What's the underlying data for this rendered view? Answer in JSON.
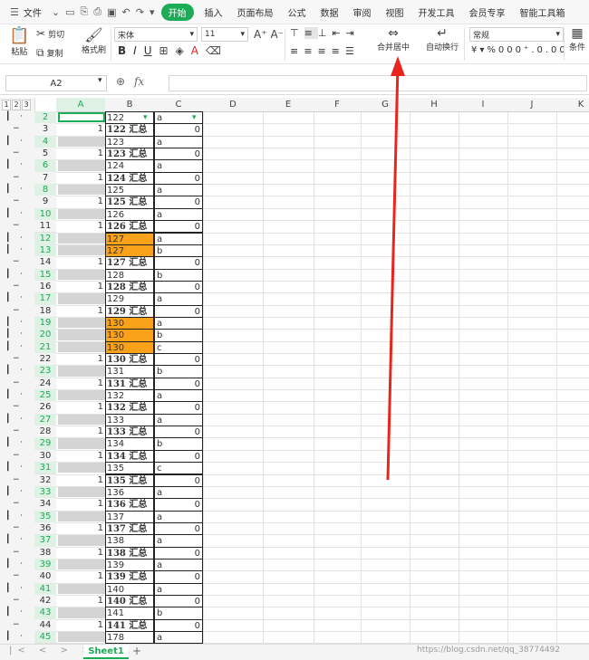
{
  "menubar": {
    "file": "文件",
    "tabs": [
      "开始",
      "插入",
      "页面布局",
      "公式",
      "数据",
      "审阅",
      "视图",
      "开发工具",
      "会员专享",
      "智能工具箱"
    ]
  },
  "ribbon": {
    "cut": "剪切",
    "paste": "粘贴",
    "copy": "复制",
    "format_painter": "格式刷",
    "font_name": "宋体",
    "font_size": "11",
    "bold": "B",
    "italic": "I",
    "underline": "U",
    "merge_center": "合并居中",
    "wrap_text": "自动换行",
    "number_format": "常规",
    "conditional": "条件"
  },
  "formula_bar": {
    "name_box": "A2",
    "fx": "fx",
    "formula": ""
  },
  "columns": [
    "A",
    "B",
    "C",
    "D",
    "E",
    "F",
    "G",
    "H",
    "I",
    "J",
    "K"
  ],
  "outline_levels": [
    "1",
    "2",
    "3"
  ],
  "rows": [
    {
      "n": "2",
      "type": "detail",
      "a": "",
      "b": "122",
      "c": "a",
      "hilite": false
    },
    {
      "n": "3",
      "type": "summary",
      "a": "1",
      "b": "122 汇总",
      "c": "0"
    },
    {
      "n": "4",
      "type": "detail",
      "a": "",
      "b": "123",
      "c": "a",
      "hilite": false
    },
    {
      "n": "5",
      "type": "summary",
      "a": "1",
      "b": "123 汇总",
      "c": "0"
    },
    {
      "n": "6",
      "type": "detail",
      "a": "",
      "b": "124",
      "c": "a",
      "hilite": false
    },
    {
      "n": "7",
      "type": "summary",
      "a": "1",
      "b": "124 汇总",
      "c": "0"
    },
    {
      "n": "8",
      "type": "detail",
      "a": "",
      "b": "125",
      "c": "a",
      "hilite": false
    },
    {
      "n": "9",
      "type": "summary",
      "a": "1",
      "b": "125 汇总",
      "c": "0"
    },
    {
      "n": "10",
      "type": "detail",
      "a": "",
      "b": "126",
      "c": "a",
      "hilite": false
    },
    {
      "n": "11",
      "type": "summary",
      "a": "1",
      "b": "126 汇总",
      "c": "0"
    },
    {
      "n": "12",
      "type": "detail",
      "a": "",
      "b": "127",
      "c": "a",
      "hilite": true
    },
    {
      "n": "13",
      "type": "detail",
      "a": "",
      "b": "127",
      "c": "b",
      "hilite": true
    },
    {
      "n": "14",
      "type": "summary",
      "a": "1",
      "b": "127 汇总",
      "c": "0"
    },
    {
      "n": "15",
      "type": "detail",
      "a": "",
      "b": "128",
      "c": "b",
      "hilite": false
    },
    {
      "n": "16",
      "type": "summary",
      "a": "1",
      "b": "128 汇总",
      "c": "0"
    },
    {
      "n": "17",
      "type": "detail",
      "a": "",
      "b": "129",
      "c": "a",
      "hilite": false
    },
    {
      "n": "18",
      "type": "summary",
      "a": "1",
      "b": "129 汇总",
      "c": "0"
    },
    {
      "n": "19",
      "type": "detail",
      "a": "",
      "b": "130",
      "c": "a",
      "hilite": true
    },
    {
      "n": "20",
      "type": "detail",
      "a": "",
      "b": "130",
      "c": "b",
      "hilite": true
    },
    {
      "n": "21",
      "type": "detail",
      "a": "",
      "b": "130",
      "c": "c",
      "hilite": true
    },
    {
      "n": "22",
      "type": "summary",
      "a": "1",
      "b": "130 汇总",
      "c": "0"
    },
    {
      "n": "23",
      "type": "detail",
      "a": "",
      "b": "131",
      "c": "b",
      "hilite": false
    },
    {
      "n": "24",
      "type": "summary",
      "a": "1",
      "b": "131 汇总",
      "c": "0"
    },
    {
      "n": "25",
      "type": "detail",
      "a": "",
      "b": "132",
      "c": "a",
      "hilite": false
    },
    {
      "n": "26",
      "type": "summary",
      "a": "1",
      "b": "132 汇总",
      "c": "0"
    },
    {
      "n": "27",
      "type": "detail",
      "a": "",
      "b": "133",
      "c": "a",
      "hilite": false
    },
    {
      "n": "28",
      "type": "summary",
      "a": "1",
      "b": "133 汇总",
      "c": "0"
    },
    {
      "n": "29",
      "type": "detail",
      "a": "",
      "b": "134",
      "c": "b",
      "hilite": false
    },
    {
      "n": "30",
      "type": "summary",
      "a": "1",
      "b": "134 汇总",
      "c": "0"
    },
    {
      "n": "31",
      "type": "detail",
      "a": "",
      "b": "135",
      "c": "c",
      "hilite": false
    },
    {
      "n": "32",
      "type": "summary",
      "a": "1",
      "b": "135 汇总",
      "c": "0"
    },
    {
      "n": "33",
      "type": "detail",
      "a": "",
      "b": "136",
      "c": "a",
      "hilite": false
    },
    {
      "n": "34",
      "type": "summary",
      "a": "1",
      "b": "136 汇总",
      "c": "0"
    },
    {
      "n": "35",
      "type": "detail",
      "a": "",
      "b": "137",
      "c": "a",
      "hilite": false
    },
    {
      "n": "36",
      "type": "summary",
      "a": "1",
      "b": "137 汇总",
      "c": "0"
    },
    {
      "n": "37",
      "type": "detail",
      "a": "",
      "b": "138",
      "c": "a",
      "hilite": false
    },
    {
      "n": "38",
      "type": "summary",
      "a": "1",
      "b": "138 汇总",
      "c": "0"
    },
    {
      "n": "39",
      "type": "detail",
      "a": "",
      "b": "139",
      "c": "a",
      "hilite": false
    },
    {
      "n": "40",
      "type": "summary",
      "a": "1",
      "b": "139 汇总",
      "c": "0"
    },
    {
      "n": "41",
      "type": "detail",
      "a": "",
      "b": "140",
      "c": "a",
      "hilite": false
    },
    {
      "n": "42",
      "type": "summary",
      "a": "1",
      "b": "140 汇总",
      "c": "0"
    },
    {
      "n": "43",
      "type": "detail",
      "a": "",
      "b": "141",
      "c": "b",
      "hilite": false
    },
    {
      "n": "44",
      "type": "summary",
      "a": "1",
      "b": "141 汇总",
      "c": "0"
    },
    {
      "n": "45",
      "type": "detail",
      "a": "",
      "b": "178",
      "c": "a",
      "hilite": false
    }
  ],
  "sheet_tab": "Sheet1",
  "watermark": "https://blog.csdn.net/qq_38774492",
  "colors": {
    "accent": "#1cab57",
    "highlight": "#f9a21a",
    "arrow": "#e8261e"
  }
}
